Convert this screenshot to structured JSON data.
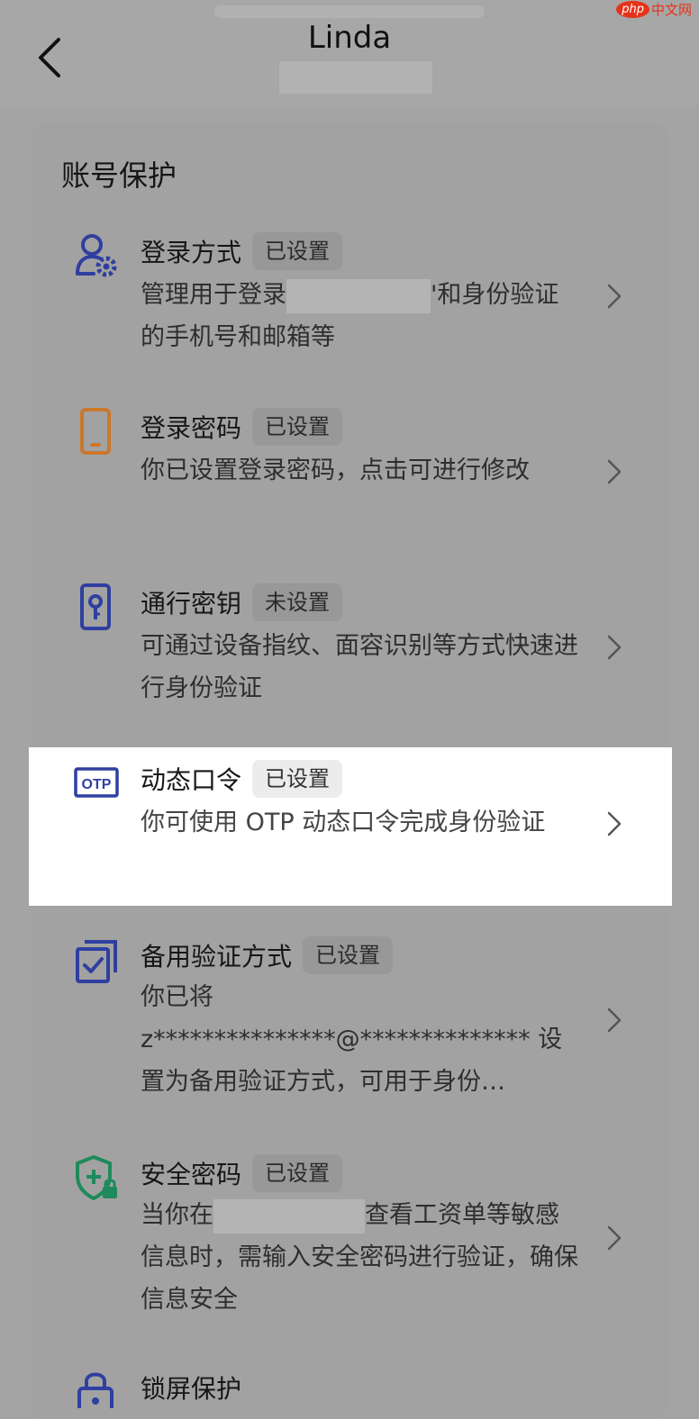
{
  "header": {
    "title": "Linda",
    "watermark_logo": "php",
    "watermark_text": "中文网"
  },
  "section": {
    "title": "账号保护"
  },
  "items": [
    {
      "title": "登录方式",
      "badge": "已设置",
      "desc_part1": "管理用于登录",
      "desc_part2": "'和身份验证的手机号和邮箱等",
      "icon": "user-gear-icon"
    },
    {
      "title": "登录密码",
      "badge": "已设置",
      "desc": "你已设置登录密码，点击可进行修改",
      "icon": "phone-icon"
    },
    {
      "title": "通行密钥",
      "badge": "未设置",
      "desc": "可通过设备指纹、面容识别等方式快速进行身份验证",
      "icon": "passkey-icon"
    },
    {
      "title": "动态口令",
      "badge": "已设置",
      "desc": "你可使用 OTP 动态口令完成身份验证",
      "icon": "otp-icon",
      "icon_text": "OTP"
    },
    {
      "title": "备用验证方式",
      "badge": "已设置",
      "desc_line1": "你已将",
      "desc_line2": "z***************@************** 设",
      "desc_line3": "置为备用验证方式，可用于身份…",
      "icon": "checkbox-stack-icon"
    },
    {
      "title": "安全密码",
      "badge": "已设置",
      "desc_part1": "当你在",
      "desc_part2": "查看工资单等敏感信息时，需输入安全密码进行验证，确保信息安全",
      "icon": "shield-lock-icon"
    },
    {
      "title": "锁屏保护",
      "icon": "lock-icon"
    }
  ],
  "colors": {
    "accent_blue": "#2f3fa0",
    "icon_orange": "#c9782c",
    "icon_green": "#1f8a5b"
  }
}
